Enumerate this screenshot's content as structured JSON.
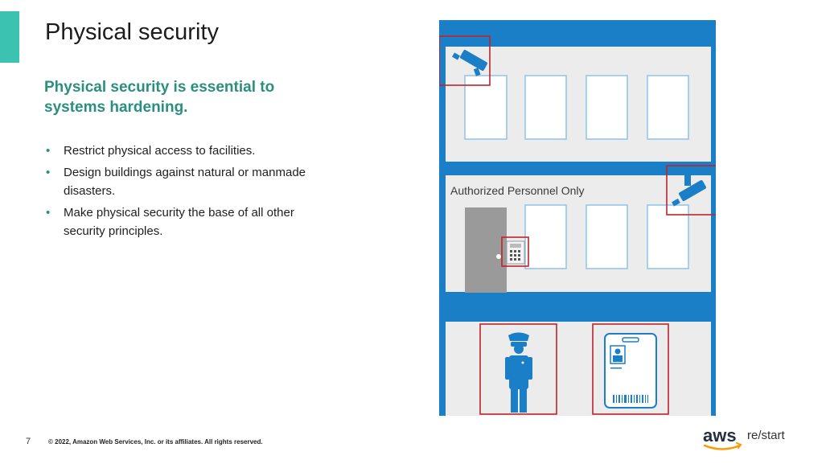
{
  "slide": {
    "title": "Physical security",
    "subtitle": "Physical security is essential to systems hardening.",
    "bullets": [
      "Restrict physical access to facilities.",
      "Design buildings against natural or manmade disasters.",
      "Make physical security the base of all other security principles."
    ],
    "page_number": "7",
    "copyright": "© 2022, Amazon Web Services, Inc. or its affiliates. All rights reserved."
  },
  "illustration": {
    "sign_text": "Authorized Personnel Only",
    "icons": [
      "security-camera-icon",
      "security-camera-icon",
      "keypad-icon",
      "security-guard-icon",
      "id-badge-icon"
    ]
  },
  "branding": {
    "logo_text": "aws",
    "product": "re/start"
  },
  "colors": {
    "accent": "#3cc2b0",
    "subtitle": "#2b8f7f",
    "building_blue": "#1a7fc6",
    "highlight_red": "#c0232b"
  }
}
